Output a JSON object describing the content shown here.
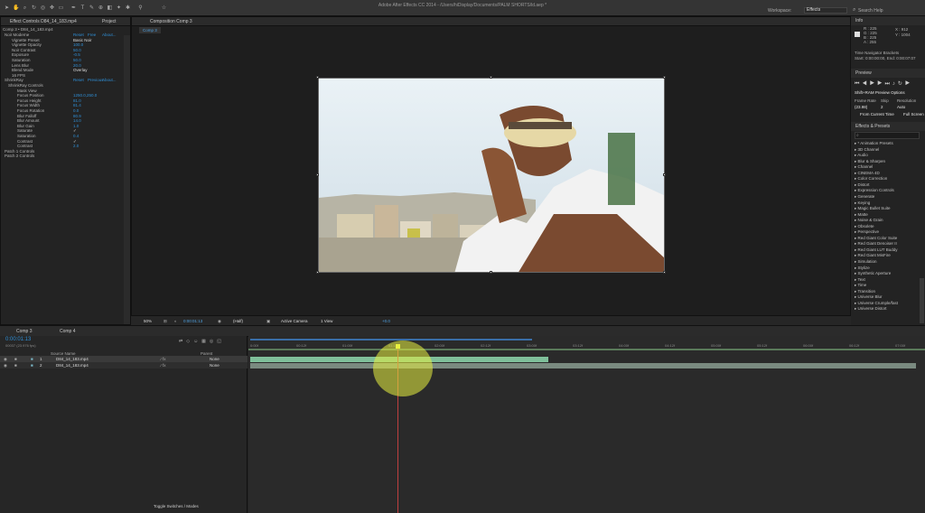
{
  "app": {
    "title": "Adobe After Effects CC 2014 - /Users/hiDisplay/Documents/PALM SHORTS/ld.aep *",
    "workspace_label": "Workspace:",
    "workspace_value": "Effects",
    "search_help": "Search Help"
  },
  "effect_controls": {
    "tab_label": "Effect Controls D84_14_183.mp4",
    "tab_project": "Project",
    "breadcrumb": "Comp 3 • D84_14_183.mp4",
    "effects": [
      {
        "name": "Noir Moderne",
        "links": [
          "Reset",
          "Free",
          "About..."
        ]
      },
      {
        "name": "ShrinkRay",
        "links": [
          "Reset",
          "Previous",
          "About..."
        ]
      }
    ],
    "noir_params": [
      {
        "label": "Vignette Preset",
        "value": "Basic Noir"
      },
      {
        "label": "Vignette Opacity",
        "value": "100.0"
      },
      {
        "label": "Noir Contrast",
        "value": "50.0"
      },
      {
        "label": "Exposure",
        "value": "-0.5"
      },
      {
        "label": "Saturation",
        "value": "50.0"
      },
      {
        "label": "Lens Blur",
        "value": "20.0"
      },
      {
        "label": "Blend Mode",
        "value": "Overlay"
      },
      {
        "label": "16 FPS",
        "value": ""
      }
    ],
    "shrink_params": [
      {
        "label": "ShrinkRay Controls",
        "value": ""
      },
      {
        "label": "Mask View",
        "value": ""
      },
      {
        "label": "Focus Position",
        "value": "1250.0,250.0"
      },
      {
        "label": "Focus Height",
        "value": "81.0"
      },
      {
        "label": "Focus Width",
        "value": "81.4"
      },
      {
        "label": "Focus Rotation",
        "value": "0.0"
      },
      {
        "label": "Blur Falloff",
        "value": "80.9"
      },
      {
        "label": "Blur Amount",
        "value": "14.0"
      },
      {
        "label": "Blur Gain",
        "value": "1.0"
      },
      {
        "label": "Saturate",
        "value": "✓"
      },
      {
        "label": "Saturation",
        "value": "0.4"
      },
      {
        "label": "Contrast",
        "value": "✓"
      },
      {
        "label": "Contrast",
        "value": "2.0"
      }
    ],
    "extra": [
      "Patch 1 Controls",
      "Patch 2 Controls"
    ]
  },
  "composition": {
    "tab_label": "Composition Comp 3",
    "comp_button": "Comp 3",
    "zoom": "50%",
    "timecode": "0:00:01:13",
    "resolution": "(Half)",
    "camera": "Active Camera",
    "view": "1 View",
    "offset": "+0.0"
  },
  "info": {
    "tab": "Info",
    "r": "R : 225",
    "g": "G : 225",
    "b": "B : 225",
    "a": "A : 255",
    "x": "X : 912",
    "y": "Y : 1004",
    "nav_title": "Time Navigator Brackets",
    "nav_range": "Start: 0:00:00:00, End: 0:00:07:07"
  },
  "preview": {
    "tab": "Preview",
    "options": "Shift+RAM Preview Options",
    "frame_rate_label": "Frame Rate",
    "skip_label": "Skip",
    "resolution_label": "Resolution",
    "frame_rate": "(23.98)",
    "skip": "2",
    "resolution": "Auto",
    "from_current": "From Current Time",
    "full_screen": "Full Screen"
  },
  "effects_presets": {
    "tab": "Effects & Presets",
    "items": [
      "* Animation Presets",
      "3D Channel",
      "Audio",
      "Blur & Sharpen",
      "Channel",
      "CINEMA 4D",
      "Color Correction",
      "Distort",
      "Expression Controls",
      "Generate",
      "Keying",
      "Magic Bullet Suite",
      "Matte",
      "Noise & Grain",
      "Obsolete",
      "Perspective",
      "Red Giant Color Suite",
      "Red Giant Denoiser II",
      "Red Giant LUT Buddy",
      "Red Giant MisFire",
      "Simulation",
      "Stylize",
      "Synthetic Aperture",
      "Text",
      "Time",
      "Transition",
      "Universe Blur",
      "Universe Crumple/fast",
      "Universe Distort"
    ]
  },
  "timeline": {
    "tab_comp3": "Comp 3",
    "tab_comp4": "Comp 4",
    "timecode": "0:00:01:13",
    "fps_line": "00037 (23.976 fps)",
    "col_source": "Source Name",
    "col_parent": "Parent",
    "layers": [
      {
        "num": "1",
        "name": "D84_14_183.mp4",
        "parent": "None"
      },
      {
        "num": "2",
        "name": "D84_14_183.mp4",
        "parent": "None"
      }
    ],
    "ticks": [
      "0:00f",
      "00:12f",
      "01:00f",
      "01:12f",
      "02:00f",
      "02:12f",
      "03:00f",
      "03:12f",
      "04:00f",
      "04:12f",
      "05:00f",
      "05:12f",
      "06:00f",
      "06:12f",
      "07:00f"
    ],
    "toggle": "Toggle Switches / Modes"
  },
  "colors": {
    "accent": "#2f8fd6",
    "layer1_bar": "#7fbf9a",
    "layer2_bar": "#7a8a80",
    "cti": "#c04040",
    "highlight": "#e8f040"
  }
}
